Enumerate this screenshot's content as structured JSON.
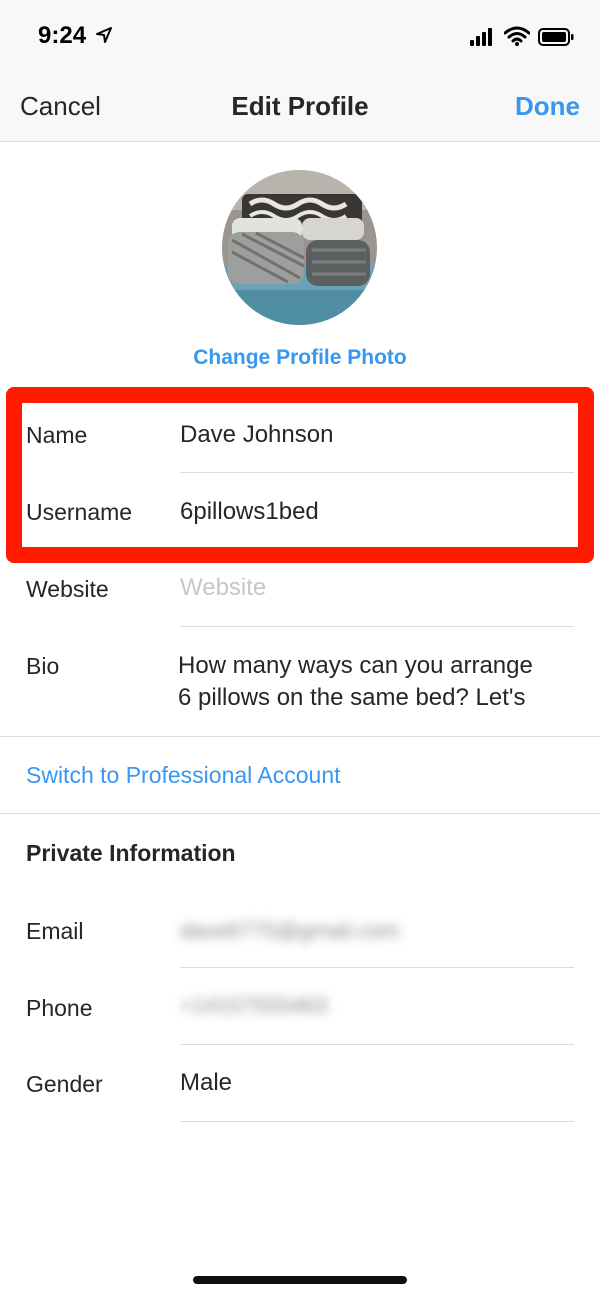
{
  "status_bar": {
    "time": "9:24",
    "icons": [
      "location-arrow-icon",
      "cellular-signal-icon",
      "wifi-icon",
      "battery-icon"
    ]
  },
  "nav": {
    "cancel_label": "Cancel",
    "title": "Edit Profile",
    "done_label": "Done"
  },
  "profile": {
    "change_photo_label": "Change Profile Photo",
    "fields": {
      "name": {
        "label": "Name",
        "value": "Dave Johnson"
      },
      "username": {
        "label": "Username",
        "value": "6pillows1bed"
      },
      "website": {
        "label": "Website",
        "value": "",
        "placeholder": "Website"
      },
      "bio": {
        "label": "Bio",
        "value": "How many ways can you arrange\n6 pillows on the same bed? Let's"
      }
    }
  },
  "switch_account_label": "Switch to Professional Account",
  "private_info": {
    "title": "Private Information",
    "email": {
      "label": "Email",
      "value": "dave6775@gmail.com"
    },
    "phone": {
      "label": "Phone",
      "value": "+14157555463"
    },
    "gender": {
      "label": "Gender",
      "value": "Male"
    }
  },
  "colors": {
    "accent": "#3897f0",
    "highlight": "#ff1a00",
    "text": "#262626"
  }
}
